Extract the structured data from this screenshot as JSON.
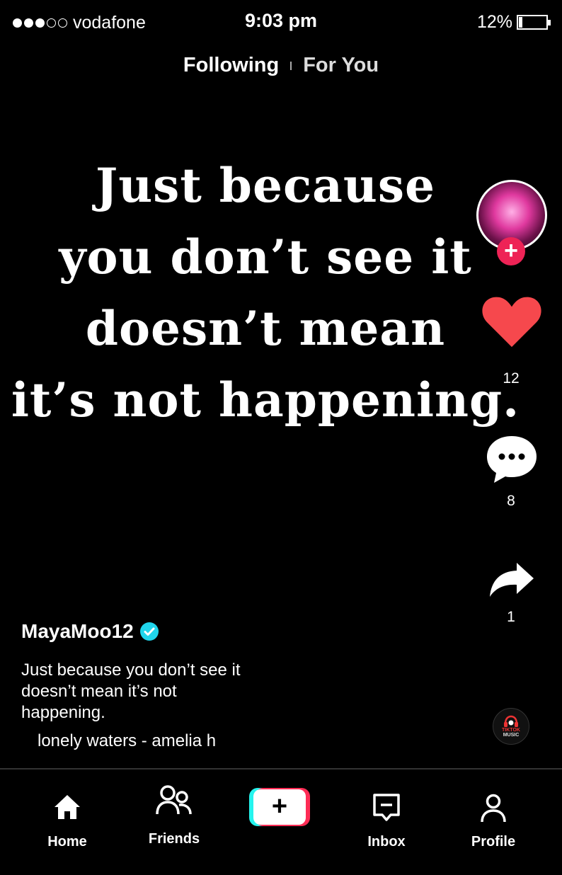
{
  "status_bar": {
    "carrier": "vodafone",
    "signal_bars_filled": 3,
    "signal_bars_total": 5,
    "time": "9:03 pm",
    "battery_percent": "12%",
    "battery_level": 0.12
  },
  "top_tabs": [
    {
      "label": "Following",
      "active": true
    },
    {
      "label": "For You",
      "active": false
    }
  ],
  "quote": {
    "lines": [
      "Just because",
      "you don’t see it",
      "doesn’t mean",
      "it’s not happening."
    ]
  },
  "actions": {
    "likes": "12",
    "comments": "8",
    "shares": "1"
  },
  "post": {
    "username": "MayaMoo12",
    "caption": "Just because you don’t see it doesn’t mean it’s not happening.",
    "sound": "lonely waters - amelia h"
  },
  "disc_label": [
    "TIKTOK",
    "MUSIC"
  ],
  "nav": {
    "home": "Home",
    "friends": "Friends",
    "inbox": "Inbox",
    "profile": "Profile"
  },
  "colors": {
    "background": "#000000",
    "like_red": "#f6484d",
    "follow_pink": "#ee2356",
    "verified_cyan": "#20d5ec",
    "accent_cyan": "#25f4ee",
    "accent_red": "#fe2c55"
  },
  "icons": [
    "home-icon",
    "friends-icon",
    "create-plus-icon",
    "inbox-icon",
    "profile-icon",
    "heart-icon",
    "comment-icon",
    "share-icon",
    "verified-badge-icon",
    "music-disc-icon"
  ]
}
